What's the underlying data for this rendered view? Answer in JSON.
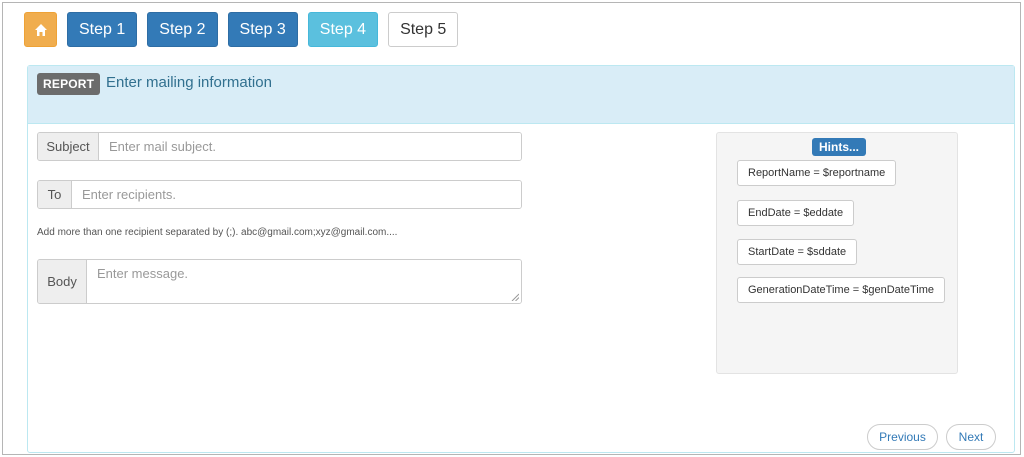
{
  "steps": {
    "home_icon": "home-icon",
    "items": [
      {
        "label": "Step 1",
        "state": "done"
      },
      {
        "label": "Step 2",
        "state": "done"
      },
      {
        "label": "Step 3",
        "state": "done"
      },
      {
        "label": "Step 4",
        "state": "active"
      },
      {
        "label": "Step 5",
        "state": "upcoming"
      }
    ]
  },
  "panel": {
    "badge": "REPORT",
    "title": "Enter mailing information"
  },
  "form": {
    "subject": {
      "label": "Subject",
      "value": "",
      "placeholder": "Enter mail subject."
    },
    "to": {
      "label": "To",
      "value": "",
      "placeholder": "Enter recipients."
    },
    "help": "Add more than one recipient separated by (;). abc@gmail.com;xyz@gmail.com....",
    "body": {
      "label": "Body",
      "value": "",
      "placeholder": "Enter message."
    }
  },
  "hints": {
    "title": "Hints...",
    "items": [
      "ReportName = $reportname",
      "EndDate = $eddate",
      "StartDate = $sddate",
      "GenerationDateTime = $genDateTime"
    ]
  },
  "footer": {
    "previous_label": "Previous",
    "next_label": "Next"
  },
  "colors": {
    "home": "#f0ad4e",
    "step_done": "#337ab7",
    "step_active": "#5bc0de",
    "panel_heading": "#d9edf7",
    "title_text": "#31708f"
  }
}
